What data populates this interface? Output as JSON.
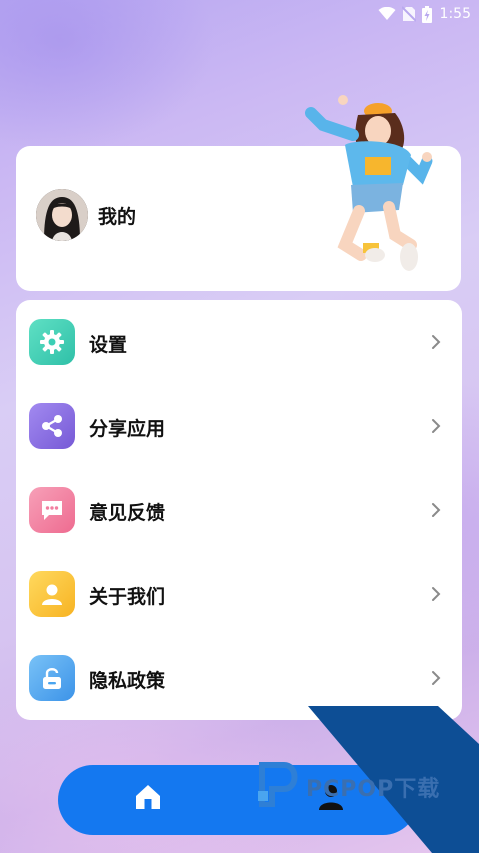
{
  "status_bar": {
    "time": "1:55",
    "icons": [
      "wifi-icon",
      "no-sim-icon",
      "battery-charging-icon"
    ]
  },
  "profile": {
    "name": "我的",
    "avatar_icon": "avatar-photo",
    "illustration": "jumping-girl-illustration"
  },
  "menu": {
    "items": [
      {
        "label": "设置",
        "icon": "gear-icon",
        "color": "#3ccfb5"
      },
      {
        "label": "分享应用",
        "icon": "share-icon",
        "color": "#8b6fe0"
      },
      {
        "label": "意见反馈",
        "icon": "chat-icon",
        "color": "#f27ea0"
      },
      {
        "label": "关于我们",
        "icon": "person-icon",
        "color": "#fbc93f"
      },
      {
        "label": "隐私政策",
        "icon": "lock-icon",
        "color": "#4aa5ef"
      }
    ]
  },
  "bottom_nav": {
    "color": "#1478f0",
    "items": [
      {
        "icon": "home-icon",
        "selected": true
      },
      {
        "icon": "profile-icon",
        "selected": false
      }
    ]
  },
  "watermark": {
    "text": "PCPOP下载"
  }
}
